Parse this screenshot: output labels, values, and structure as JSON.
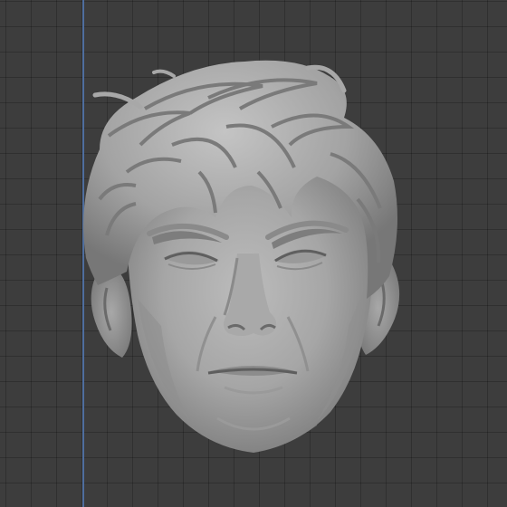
{
  "viewport": {
    "background_color": "#3d3d3d",
    "grid_color": "#333333",
    "axis_color": "#4f6e9e",
    "object": {
      "name": "sculpted-male-head",
      "material_color": "#a9a9a9",
      "shadow_color": "#5e5e5e",
      "highlight_color": "#cfcfcf"
    }
  }
}
